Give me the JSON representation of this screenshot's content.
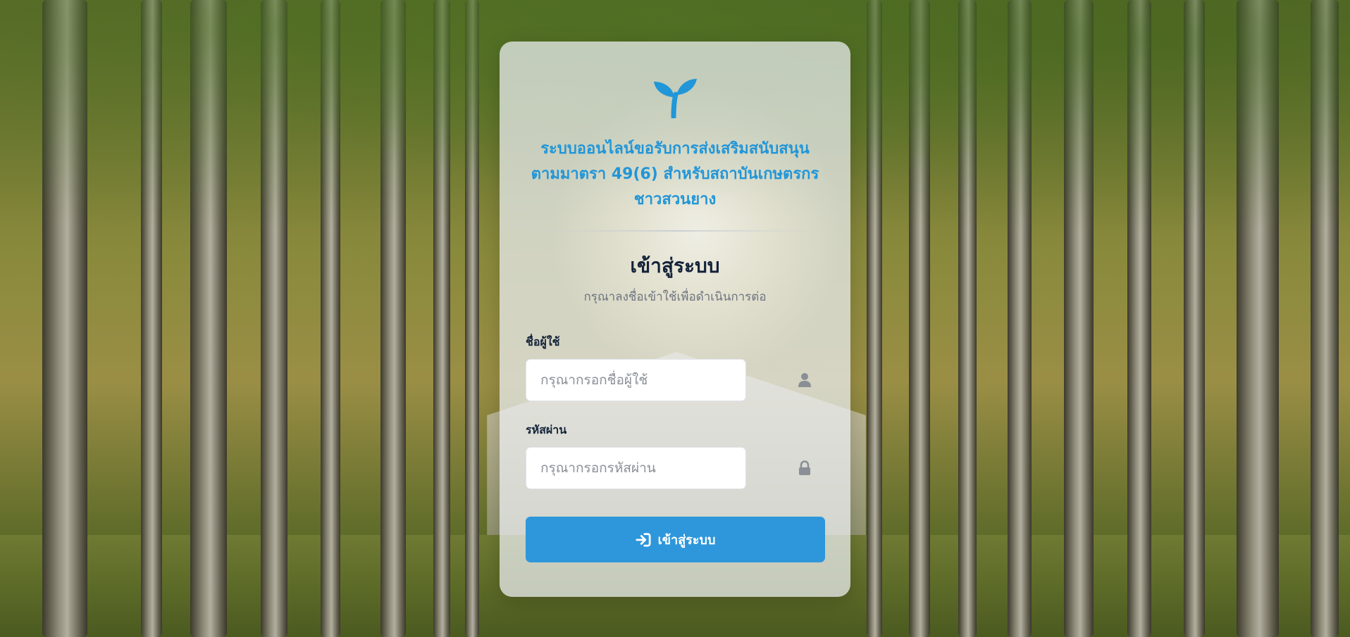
{
  "branding": {
    "logo_icon": "sprout-icon",
    "accent_color": "#2196d8",
    "title_lines": [
      "ระบบออนไลน์ขอรับการส่งเสริมสนับสนุน",
      "ตามมาตรา 49(6) สำหรับสถาบันเกษตรกร",
      "ชาวสวนยาง"
    ]
  },
  "login": {
    "heading": "เข้าสู่ระบบ",
    "subtitle": "กรุณาลงชื่อเข้าใช้เพื่อดำเนินการต่อ",
    "username": {
      "label": "ชื่อผู้ใช้",
      "placeholder": "กรุณากรอกชื่อผู้ใช้",
      "value": "",
      "icon": "user-icon"
    },
    "password": {
      "label": "รหัสผ่าน",
      "placeholder": "กรุณากรอกรหัสผ่าน",
      "value": "",
      "icon": "lock-icon"
    },
    "submit": {
      "label": "เข้าสู่ระบบ",
      "icon": "sign-in-icon",
      "color": "#2e97db"
    }
  }
}
